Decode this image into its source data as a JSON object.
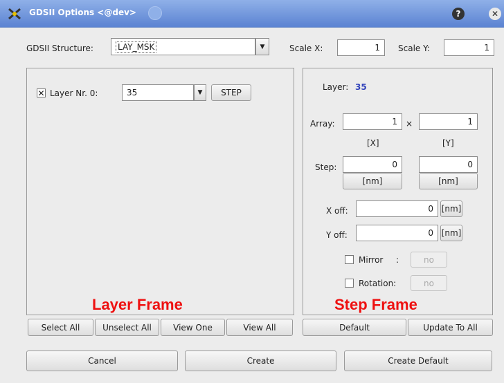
{
  "window": {
    "title": "GDSII Options <@dev>"
  },
  "colors": {
    "accent_red": "#ee1111",
    "layer_value_blue": "#3344bb",
    "titlebar": "#6f93d9"
  },
  "top": {
    "structure_label": "GDSII Structure:",
    "structure_value": "LAY_MSK",
    "scale_x_label": "Scale X:",
    "scale_x_value": "1",
    "scale_y_label": "Scale Y:",
    "scale_y_value": "1"
  },
  "layer_frame": {
    "checkbox_mark": "✕",
    "layer_label": "Layer Nr. 0:",
    "layer_value": "35",
    "step_button": "STEP",
    "caption": "Layer Frame",
    "buttons": [
      "Select All",
      "Unselect All",
      "View One",
      "View All"
    ]
  },
  "step_frame": {
    "layer_label": "Layer:",
    "layer_value": "35",
    "array_label": "Array:",
    "array_x": "1",
    "times": "×",
    "array_y": "1",
    "x_unit": "[X]",
    "y_unit": "[Y]",
    "step_label": "Step:",
    "step_x": "0",
    "step_y": "0",
    "nm": "[nm]",
    "xoff_label": "X off:",
    "xoff_value": "0",
    "yoff_label": "Y off:",
    "yoff_value": "0",
    "mirror_label": "Mirror",
    "colon": ":",
    "rotation_label": "Rotation:",
    "no": "no",
    "caption": "Step Frame",
    "default_button": "Default",
    "update_button": "Update To All"
  },
  "bottom": {
    "cancel": "Cancel",
    "create": "Create",
    "create_default": "Create Default"
  },
  "icons": [
    "app-icon",
    "help-icon",
    "close-icon",
    "dropdown-arrow-icon"
  ]
}
